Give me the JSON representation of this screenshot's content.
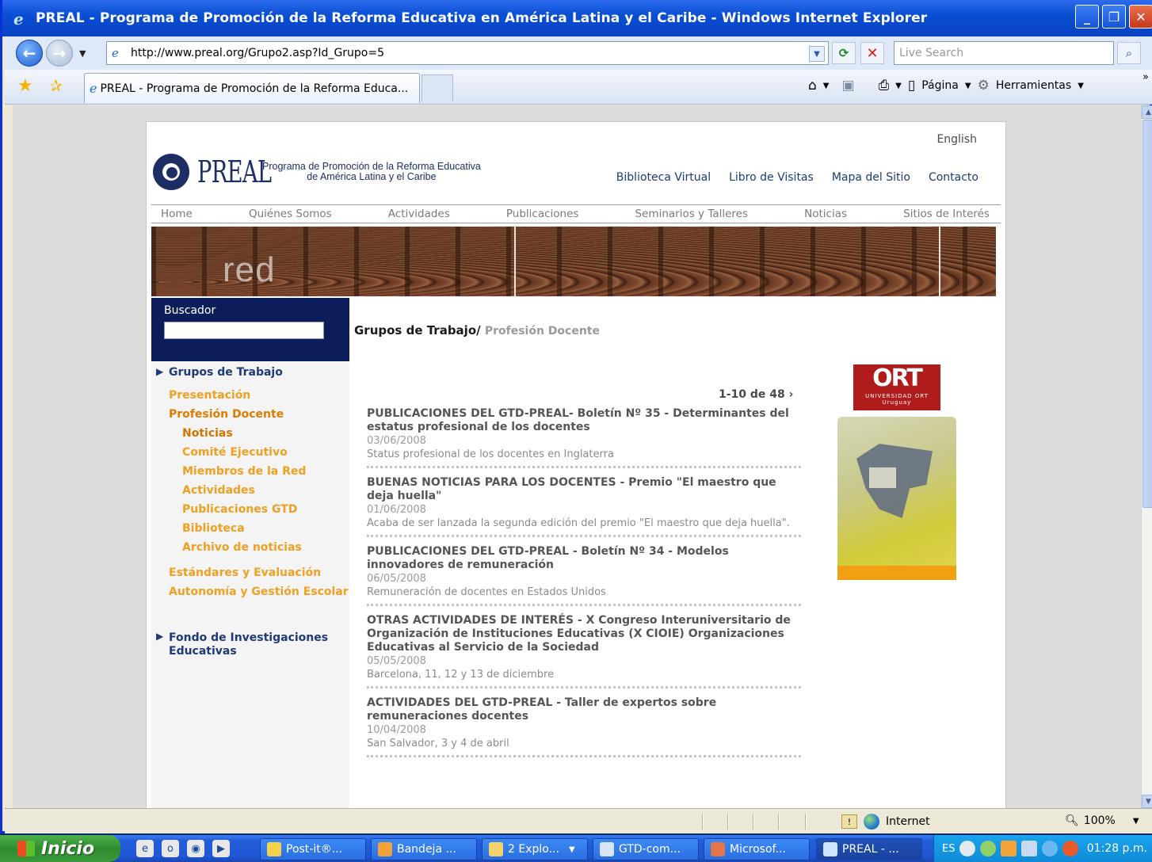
{
  "window": {
    "title": "PREAL - Programa de Promoción de la Reforma Educativa en América Latina y el Caribe - Windows Internet Explorer"
  },
  "browser": {
    "url": "http://www.preal.org/Grupo2.asp?Id_Grupo=5",
    "search_placeholder": "Live Search",
    "tab_title": "PREAL - Programa de Promoción de la Reforma Educa...",
    "page_menu": "Página",
    "tools_menu": "Herramientas",
    "status_zone": "Internet",
    "zoom": "100%"
  },
  "site": {
    "lang_link": "English",
    "logo_word": "PREAL",
    "tagline_line1": "Programa de Promoción de la Reforma Educativa",
    "tagline_line2": "de América Latina y el Caribe",
    "util_nav": [
      "Biblioteca Virtual",
      "Libro de Visitas",
      "Mapa del Sitio",
      "Contacto"
    ],
    "main_nav": [
      "Home",
      "Quiénes Somos",
      "Actividades",
      "Publicaciones",
      "Seminarios y Talleres",
      "Noticias",
      "Sitios de Interés"
    ],
    "banner_word": "red"
  },
  "sidebar": {
    "search_label": "Buscador",
    "group1": "Grupos de Trabajo",
    "items": [
      "Presentación",
      "Profesión Docente",
      "Noticias",
      "Comité Ejecutivo",
      "Miembros de la Red",
      "Actividades",
      "Publicaciones GTD",
      "Biblioteca",
      "Archivo de noticias",
      "Estándares y Evaluación",
      "Autonomía y Gestión Escolar"
    ],
    "group2_line1": "Fondo de Investigaciones",
    "group2_line2": "Educativas"
  },
  "content": {
    "breadcrumb_main": "Grupos de Trabajo/",
    "breadcrumb_sub": "Profesión Docente",
    "pager": "1-10 de 48",
    "news": [
      {
        "title": "PUBLICACIONES DEL GTD-PREAL- Boletín Nº 35 - Determinantes del estatus profesional de los docentes",
        "date": "03/06/2008",
        "summary": "Status profesional de los docentes en Inglaterra"
      },
      {
        "title": "BUENAS NOTICIAS PARA LOS DOCENTES - Premio \"El maestro que deja huella\"",
        "date": "01/06/2008",
        "summary": "Acaba de ser lanzada la segunda edición del premio \"El maestro que deja huella\"."
      },
      {
        "title": "PUBLICACIONES DEL GTD-PREAL - Boletín Nº 34 - Modelos innovadores de remuneración",
        "date": "06/05/2008",
        "summary": "Remuneración de docentes en Estados Unidos"
      },
      {
        "title": "OTRAS ACTIVIDADES DE INTERÉS - X Congreso Interuniversitario de Organización de Instituciones Educativas (X CIOIE) Organizaciones Educativas al Servicio de la Sociedad",
        "date": "05/05/2008",
        "summary": "Barcelona, 11, 12 y 13 de diciembre"
      },
      {
        "title": "ACTIVIDADES DEL GTD-PREAL - Taller de expertos sobre remuneraciones docentes",
        "date": "10/04/2008",
        "summary": "San Salvador, 3 y 4 de abril"
      }
    ],
    "ad_logo": "ORT",
    "ad_logo_sub": "UNIVERSIDAD ORT Uruguay"
  },
  "taskbar": {
    "start_label": "Inicio",
    "buttons": [
      "Post-it®...",
      "Bandeja ...",
      "2 Explo...",
      "GTD-com...",
      "Microsof...",
      "PREAL - ..."
    ],
    "lang": "ES",
    "clock": "01:28 p.m."
  }
}
